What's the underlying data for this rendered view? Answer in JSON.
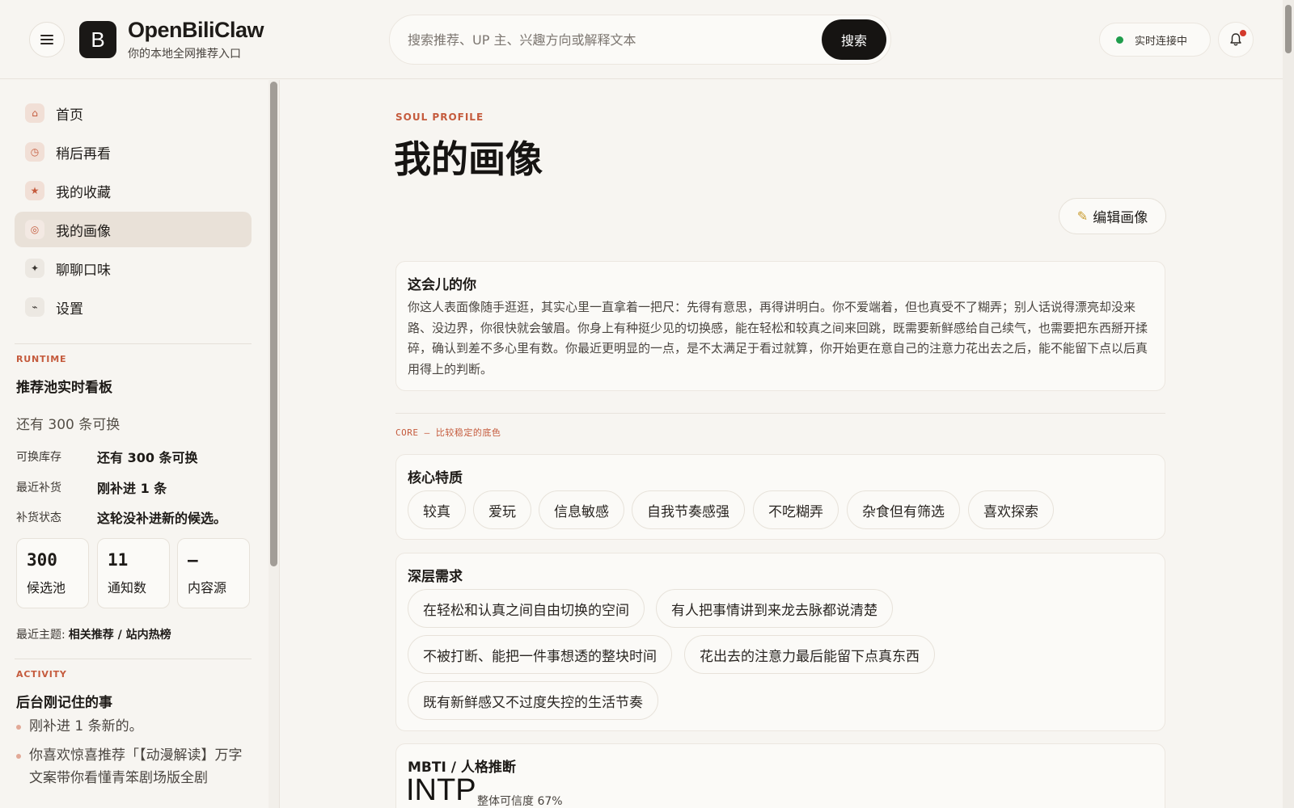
{
  "header": {
    "logo_letter": "B",
    "brand": "OpenBiliClaw",
    "tagline": "你的本地全网推荐入口",
    "search_placeholder": "搜索推荐、UP 主、兴趣方向或解释文本",
    "search_button": "搜索",
    "status": "实时连接中",
    "status_color": "#1f9d4c",
    "notification_dot_color": "#d33a2c"
  },
  "sidebar": {
    "nav": [
      {
        "label": "首页",
        "icon": "home-icon",
        "glyph": "⌂"
      },
      {
        "label": "稍后再看",
        "icon": "clock-icon",
        "glyph": "◷"
      },
      {
        "label": "我的收藏",
        "icon": "star-icon",
        "glyph": "★"
      },
      {
        "label": "我的画像",
        "icon": "target-icon",
        "glyph": "◎",
        "active": true
      },
      {
        "label": "聊聊口味",
        "icon": "sparkle-icon",
        "glyph": "✦"
      },
      {
        "label": "设置",
        "icon": "wrench-icon",
        "glyph": "⌁"
      }
    ],
    "runtime": {
      "eyebrow": "RUNTIME",
      "title": "推荐池实时看板",
      "stock_line": "还有 300 条可换",
      "rows": [
        {
          "label": "可换库存",
          "value": "还有 300 条可换"
        },
        {
          "label": "最近补货",
          "value": "刚补进 1 条"
        },
        {
          "label": "补货状态",
          "value": "这轮没补进新的候选。"
        }
      ],
      "stats": [
        {
          "value": "300",
          "label": "候选池"
        },
        {
          "value": "11",
          "label": "通知数"
        },
        {
          "value": "—",
          "label": "内容源"
        }
      ],
      "topic_label": "最近主题:",
      "topic_value": "相关推荐 / 站内热榜"
    },
    "activity": {
      "eyebrow": "ACTIVITY",
      "title": "后台刚记住的事",
      "items": [
        "刚补进 1 条新的。",
        "你喜欢惊喜推荐「【动漫解读】万字文案带你看懂青笨剧场版全剧"
      ]
    }
  },
  "main": {
    "eyebrow": "SOUL PROFILE",
    "title": "我的画像",
    "edit_button": "编辑画像",
    "now_card": {
      "title": "这会儿的你",
      "body": "你这人表面像随手逛逛，其实心里一直拿着一把尺：先得有意思，再得讲明白。你不爱端着，但也真受不了糊弄；别人话说得漂亮却没来路、没边界，你很快就会皱眉。你身上有种挺少见的切换感，能在轻松和较真之间来回跳，既需要新鲜感给自己续气，也需要把东西掰开揉碎，确认到差不多心里有数。你最近更明显的一点，是不太满足于看过就算，你开始更在意自己的注意力花出去之后，能不能留下点以后真用得上的判断。"
    },
    "core_eyebrow": "CORE — 比较稳定的底色",
    "traits": {
      "title": "核心特质",
      "chips": [
        "较真",
        "爱玩",
        "信息敏感",
        "自我节奏感强",
        "不吃糊弄",
        "杂食但有筛选",
        "喜欢探索"
      ]
    },
    "needs": {
      "title": "深层需求",
      "chips": [
        "在轻松和认真之间自由切换的空间",
        "有人把事情讲到来龙去脉都说清楚",
        "不被打断、能把一件事想透的整块时间",
        "花出去的注意力最后能留下点真东西",
        "既有新鲜感又不过度失控的生活节奏"
      ]
    },
    "mbti": {
      "title": "MBTI / 人格推断",
      "type": "INTP",
      "confidence": "整体可信度 67%"
    }
  }
}
